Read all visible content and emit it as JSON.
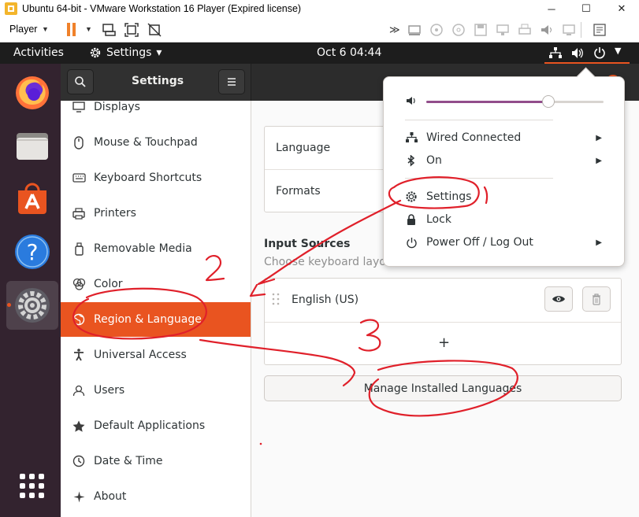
{
  "vm_window": {
    "title": "Ubuntu 64-bit - VMware Workstation 16 Player (Expired license)",
    "minimize_glyph": "─",
    "maximize_glyph": "☐",
    "close_glyph": "✕",
    "player_menu": "Player",
    "toolbar_icons": [
      "pause-icon",
      "send-ctrl-alt-del-icon",
      "fit-guest-icon",
      "unity-icon",
      "fast-forward-icon",
      "removable-devices-icon",
      "usb-icon",
      "cd-icon",
      "floppy-icon",
      "network-icon",
      "printer-icon",
      "sound-icon",
      "display-icon",
      "message-icon"
    ]
  },
  "topbar": {
    "activities": "Activities",
    "app_menu": "Settings",
    "app_menu_arrow": "▾",
    "clock": "Oct 6  04:44"
  },
  "dock": {
    "items": [
      "firefox-icon",
      "files-icon",
      "ubuntu-software-icon",
      "help-icon",
      "settings-icon"
    ],
    "apps_grid": "show-applications-icon"
  },
  "settings": {
    "header_title": "Settings",
    "sidebar": [
      {
        "label": "Displays",
        "icon": "display-icon"
      },
      {
        "label": "Mouse & Touchpad",
        "icon": "mouse-icon"
      },
      {
        "label": "Keyboard Shortcuts",
        "icon": "keyboard-icon"
      },
      {
        "label": "Printers",
        "icon": "printer-icon"
      },
      {
        "label": "Removable Media",
        "icon": "media-icon"
      },
      {
        "label": "Color",
        "icon": "color-icon"
      },
      {
        "label": "Region & Language",
        "icon": "globe-icon",
        "selected": true
      },
      {
        "label": "Universal Access",
        "icon": "accessibility-icon"
      },
      {
        "label": "Users",
        "icon": "users-icon"
      },
      {
        "label": "Default Applications",
        "icon": "star-icon"
      },
      {
        "label": "Date & Time",
        "icon": "clock-icon"
      },
      {
        "label": "About",
        "icon": "about-icon"
      }
    ],
    "language_label": "Language",
    "formats_label": "Formats",
    "input_sources_title": "Input Sources",
    "input_sources_subtitle": "Choose keyboard layou",
    "input_source_item": "English (US)",
    "add_glyph": "+",
    "manage_button": "Manage Installed Languages"
  },
  "system_menu": {
    "volume_level": 0.69,
    "items": [
      {
        "label": "Wired Connected",
        "icon": "network-wired-icon",
        "submenu": true
      },
      {
        "label": "On",
        "icon": "bluetooth-icon",
        "submenu": true
      },
      {
        "label": "Settings",
        "icon": "settings-gear-icon",
        "submenu": false
      },
      {
        "label": "Lock",
        "icon": "lock-icon",
        "submenu": false
      },
      {
        "label": "Power Off / Log Out",
        "icon": "power-icon",
        "submenu": true
      }
    ],
    "submenu_arrow": "▶"
  },
  "annotations": {
    "labels": [
      "1",
      "2",
      "3"
    ],
    "color": "#e0202a"
  },
  "colors": {
    "accent": "#e95420",
    "dock_bg": "#33232f",
    "topbar_bg": "#1d1d1d",
    "volume_fill": "#924d8b"
  }
}
